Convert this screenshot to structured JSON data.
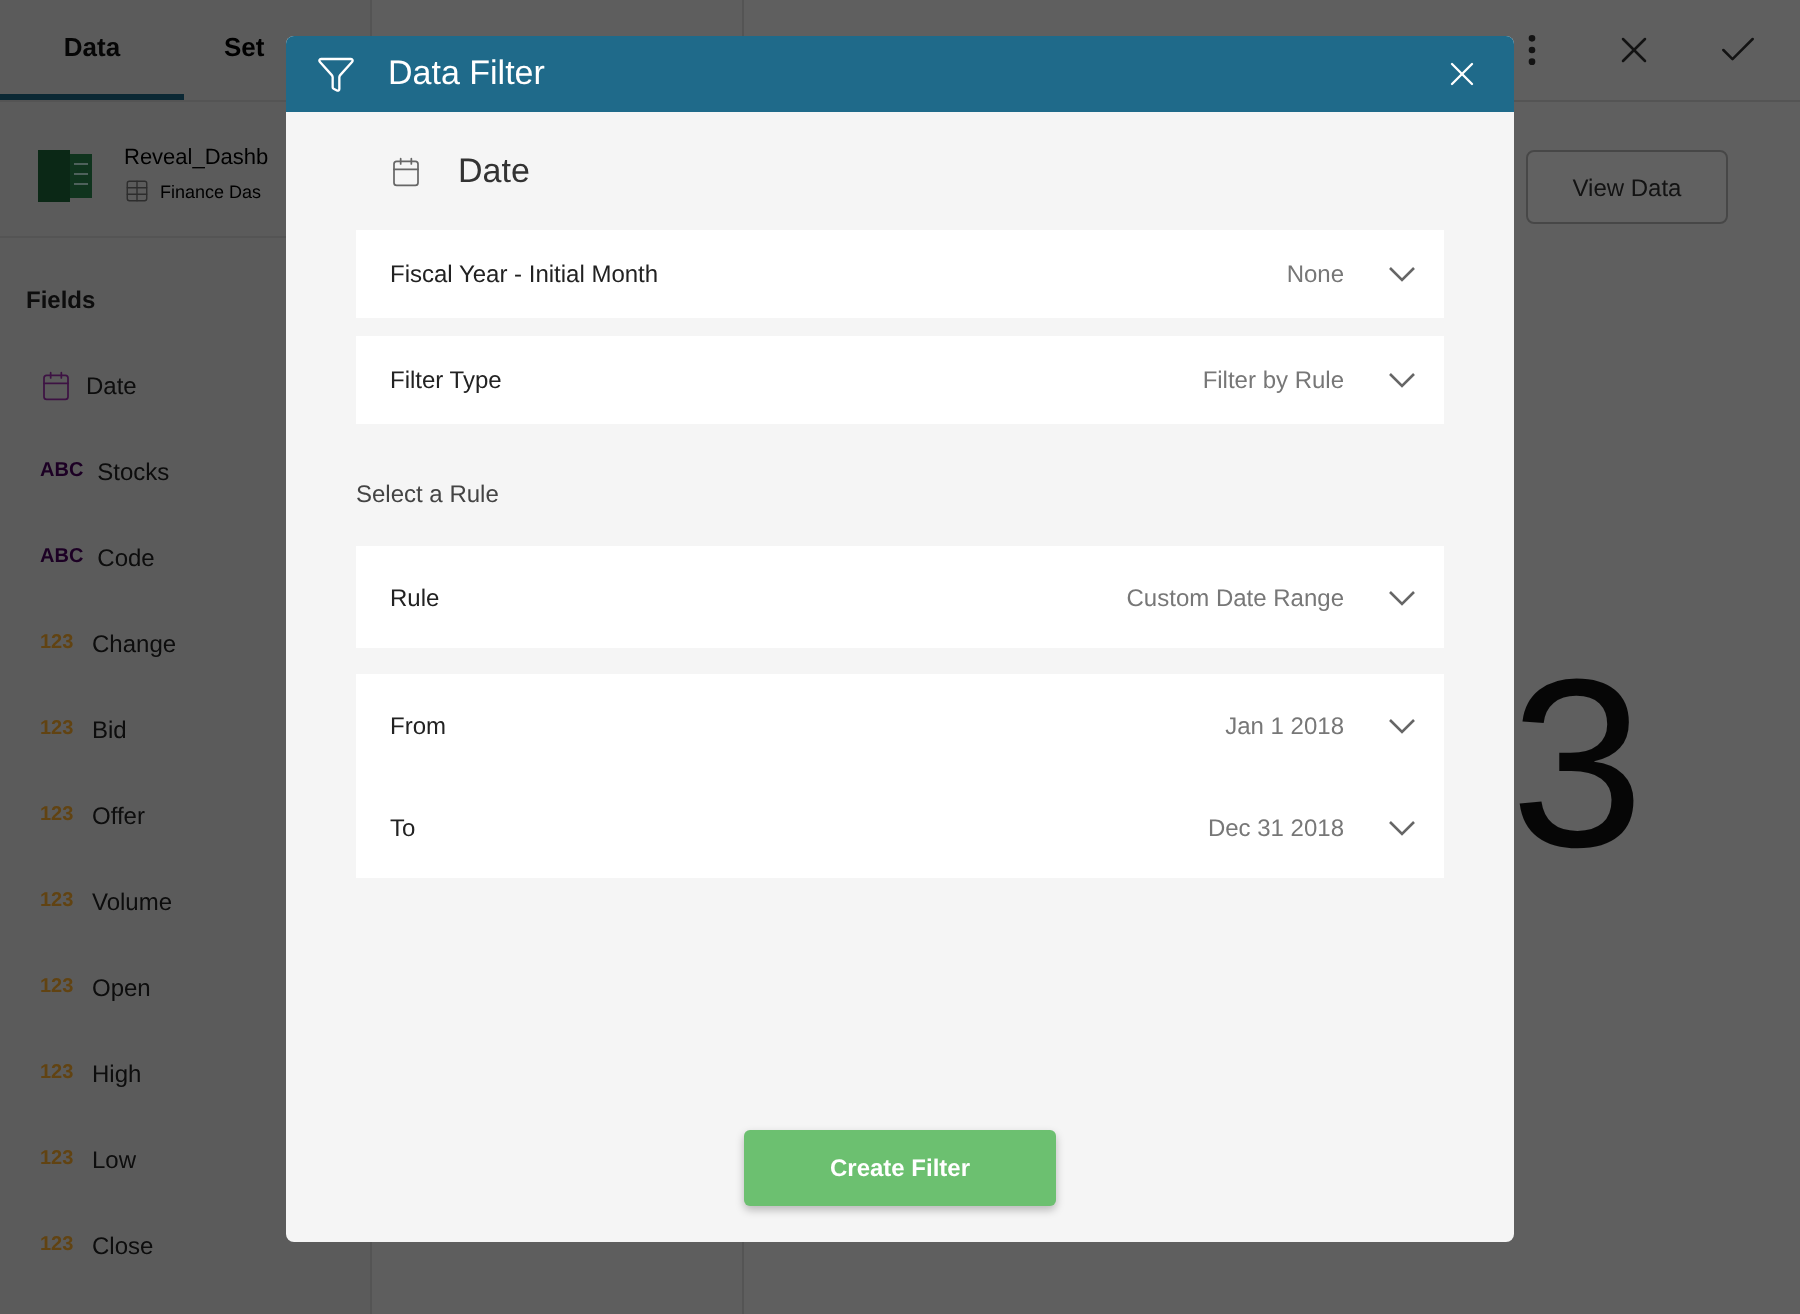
{
  "tabs": [
    {
      "label": "Data",
      "selected": true
    },
    {
      "label": "Set",
      "selected": false
    }
  ],
  "source": {
    "name": "Reveal_Dashb",
    "sheet": "Finance Das"
  },
  "fields_heading": "Fields",
  "fields": [
    {
      "kind": "date",
      "label": "Date"
    },
    {
      "kind": "text",
      "type_label": "ABC",
      "label": "Stocks"
    },
    {
      "kind": "text",
      "type_label": "ABC",
      "label": "Code"
    },
    {
      "kind": "number",
      "type_label": "123",
      "label": "Change"
    },
    {
      "kind": "number",
      "type_label": "123",
      "label": "Bid"
    },
    {
      "kind": "number",
      "type_label": "123",
      "label": "Offer"
    },
    {
      "kind": "number",
      "type_label": "123",
      "label": "Volume"
    },
    {
      "kind": "number",
      "type_label": "123",
      "label": "Open"
    },
    {
      "kind": "number",
      "type_label": "123",
      "label": "High"
    },
    {
      "kind": "number",
      "type_label": "123",
      "label": "Low"
    },
    {
      "kind": "number",
      "type_label": "123",
      "label": "Close"
    }
  ],
  "view_data_button": "View Data",
  "big_value": "3",
  "dialog": {
    "title": "Data Filter",
    "field_name": "Date",
    "settings": [
      {
        "label": "Fiscal Year - Initial Month",
        "value": "None"
      },
      {
        "label": "Filter Type",
        "value": "Filter by Rule"
      }
    ],
    "rule_heading": "Select a Rule",
    "rule": {
      "label": "Rule",
      "value": "Custom Date Range"
    },
    "range": [
      {
        "label": "From",
        "value": "Jan 1 2018"
      },
      {
        "label": "To",
        "value": "Dec 31 2018"
      }
    ],
    "create_button": "Create Filter"
  }
}
